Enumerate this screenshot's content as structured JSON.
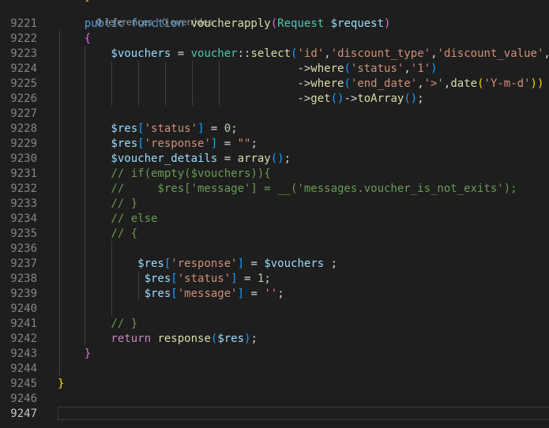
{
  "editor": {
    "colors": {
      "background": "#1e1e1e",
      "keyword": "#569cd6",
      "function": "#dcdcaa",
      "type": "#4ec9b0",
      "variable": "#9cdcfe",
      "string": "#ce9178",
      "number": "#b5cea8",
      "comment": "#6a9955",
      "bracket_level1": "#ffd700",
      "bracket_level2": "#da70d6",
      "bracket_level3": "#179fff",
      "line_number": "#858585"
    },
    "top_fragment": "}",
    "codelens": {
      "references": "0 references",
      "separator": " | ",
      "overrides": "0 overrides"
    },
    "active_line": "9247",
    "lines": [
      {
        "number": "9221",
        "tokens": [
          [
            "kw",
            "    public "
          ],
          [
            "kw",
            "function "
          ],
          [
            "fn",
            "voucherapply"
          ],
          [
            "b2",
            "("
          ],
          [
            "ty",
            "Request "
          ],
          [
            "var",
            "$request"
          ],
          [
            "b2",
            ")"
          ]
        ]
      },
      {
        "number": "9222",
        "tokens": [
          [
            "b2",
            "    {"
          ]
        ]
      },
      {
        "number": "9223",
        "tokens": [
          [
            "var",
            "        $vouchers"
          ],
          [
            "op",
            " = "
          ],
          [
            "ty",
            "voucher"
          ],
          [
            "op",
            "::"
          ],
          [
            "fn",
            "select"
          ],
          [
            "b3",
            "("
          ],
          [
            "str",
            "'id'"
          ],
          [
            "op",
            ","
          ],
          [
            "str",
            "'discount_type'"
          ],
          [
            "op",
            ","
          ],
          [
            "str",
            "'discount_value'"
          ],
          [
            "op",
            ","
          ]
        ]
      },
      {
        "number": "9224",
        "tokens": [
          [
            "op",
            "                                    ->"
          ],
          [
            "fn",
            "where"
          ],
          [
            "b3",
            "("
          ],
          [
            "str",
            "'status'"
          ],
          [
            "op",
            ","
          ],
          [
            "str",
            "'1'"
          ],
          [
            "b3",
            ")"
          ]
        ]
      },
      {
        "number": "9225",
        "tokens": [
          [
            "op",
            "                                    ->"
          ],
          [
            "fn",
            "where"
          ],
          [
            "b3",
            "("
          ],
          [
            "str",
            "'end_date'"
          ],
          [
            "op",
            ","
          ],
          [
            "str",
            "'>'"
          ],
          [
            "op",
            ","
          ],
          [
            "fn",
            "date"
          ],
          [
            "b1",
            "("
          ],
          [
            "str",
            "'Y-m-d'"
          ],
          [
            "b1",
            "))"
          ]
        ]
      },
      {
        "number": "9226",
        "tokens": [
          [
            "op",
            "                                    ->"
          ],
          [
            "fn",
            "get"
          ],
          [
            "b3",
            "()"
          ],
          [
            "op",
            "->"
          ],
          [
            "fn",
            "toArray"
          ],
          [
            "b3",
            "()"
          ],
          [
            "op",
            ";"
          ]
        ]
      },
      {
        "number": "9227",
        "tokens": []
      },
      {
        "number": "9228",
        "tokens": [
          [
            "var",
            "        $res"
          ],
          [
            "b3",
            "["
          ],
          [
            "str",
            "'status'"
          ],
          [
            "b3",
            "]"
          ],
          [
            "op",
            " = "
          ],
          [
            "num",
            "0"
          ],
          [
            "op",
            ";"
          ]
        ]
      },
      {
        "number": "9229",
        "tokens": [
          [
            "var",
            "        $res"
          ],
          [
            "b3",
            "["
          ],
          [
            "str",
            "'response'"
          ],
          [
            "b3",
            "]"
          ],
          [
            "op",
            " = "
          ],
          [
            "str",
            "\"\""
          ],
          [
            "op",
            ";"
          ]
        ]
      },
      {
        "number": "9230",
        "tokens": [
          [
            "var",
            "        $voucher_details"
          ],
          [
            "op",
            " = "
          ],
          [
            "fn",
            "array"
          ],
          [
            "b3",
            "()"
          ],
          [
            "op",
            ";"
          ]
        ]
      },
      {
        "number": "9231",
        "tokens": [
          [
            "com",
            "        // if(empty($vouchers)){"
          ]
        ]
      },
      {
        "number": "9232",
        "tokens": [
          [
            "com",
            "        //     $res['message'] = __('messages.voucher_is_not_exits');"
          ]
        ]
      },
      {
        "number": "9233",
        "tokens": [
          [
            "com",
            "        // }"
          ]
        ]
      },
      {
        "number": "9234",
        "tokens": [
          [
            "com",
            "        // else"
          ]
        ]
      },
      {
        "number": "9235",
        "tokens": [
          [
            "com",
            "        // {"
          ]
        ]
      },
      {
        "number": "9236",
        "tokens": []
      },
      {
        "number": "9237",
        "tokens": [
          [
            "var",
            "            $res"
          ],
          [
            "b3",
            "["
          ],
          [
            "str",
            "'response'"
          ],
          [
            "b3",
            "]"
          ],
          [
            "op",
            " = "
          ],
          [
            "var",
            "$vouchers"
          ],
          [
            "op",
            " ;"
          ]
        ]
      },
      {
        "number": "9238",
        "tokens": [
          [
            "var",
            "             $res"
          ],
          [
            "b3",
            "["
          ],
          [
            "str",
            "'status'"
          ],
          [
            "b3",
            "]"
          ],
          [
            "op",
            " = "
          ],
          [
            "num",
            "1"
          ],
          [
            "op",
            ";"
          ]
        ]
      },
      {
        "number": "9239",
        "tokens": [
          [
            "var",
            "             $res"
          ],
          [
            "b3",
            "["
          ],
          [
            "str",
            "'message'"
          ],
          [
            "b3",
            "]"
          ],
          [
            "op",
            " = "
          ],
          [
            "str",
            "''"
          ],
          [
            "op",
            ";"
          ]
        ]
      },
      {
        "number": "9240",
        "tokens": []
      },
      {
        "number": "9241",
        "tokens": [
          [
            "com",
            "        // }"
          ]
        ]
      },
      {
        "number": "9242",
        "tokens": [
          [
            "ctl",
            "        return "
          ],
          [
            "fn",
            "response"
          ],
          [
            "b3",
            "("
          ],
          [
            "var",
            "$res"
          ],
          [
            "b3",
            ")"
          ],
          [
            "op",
            ";"
          ]
        ]
      },
      {
        "number": "9243",
        "tokens": [
          [
            "b2",
            "    }"
          ]
        ]
      },
      {
        "number": "9244",
        "tokens": []
      },
      {
        "number": "9245",
        "tokens": [
          [
            "b1",
            "}"
          ]
        ]
      },
      {
        "number": "9246",
        "tokens": []
      },
      {
        "number": "9247",
        "tokens": []
      }
    ]
  }
}
